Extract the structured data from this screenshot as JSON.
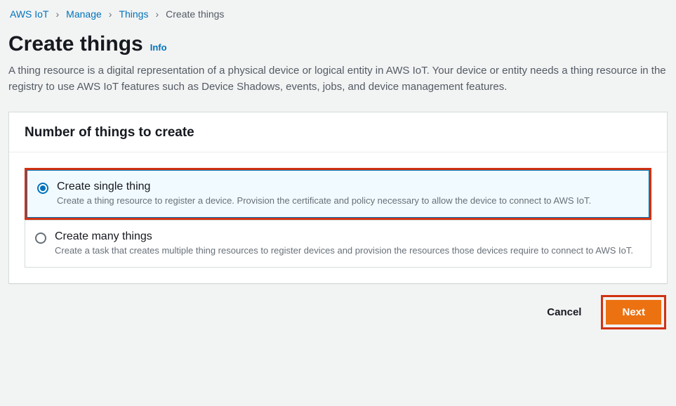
{
  "breadcrumb": {
    "items": [
      "AWS IoT",
      "Manage",
      "Things"
    ],
    "current": "Create things"
  },
  "page": {
    "title": "Create things",
    "info_label": "Info",
    "description": "A thing resource is a digital representation of a physical device or logical entity in AWS IoT. Your device or entity needs a thing resource in the registry to use AWS IoT features such as Device Shadows, events, jobs, and device management features."
  },
  "card": {
    "header": "Number of things to create",
    "options": [
      {
        "title": "Create single thing",
        "sub": "Create a thing resource to register a device. Provision the certificate and policy necessary to allow the device to connect to AWS IoT.",
        "selected": true
      },
      {
        "title": "Create many things",
        "sub": "Create a task that creates multiple thing resources to register devices and provision the resources those devices require to connect to AWS IoT.",
        "selected": false
      }
    ]
  },
  "footer": {
    "cancel": "Cancel",
    "next": "Next"
  },
  "colors": {
    "link": "#0073bb",
    "highlight": "#d13212",
    "primary": "#ec7211"
  }
}
